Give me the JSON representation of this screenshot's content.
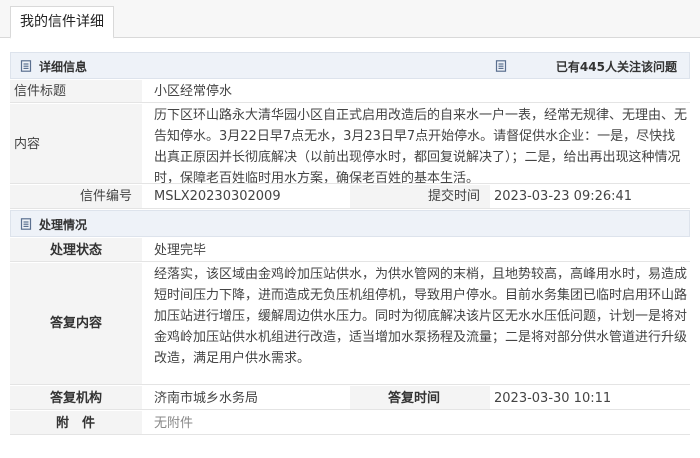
{
  "tab": {
    "label": "我的信件详细"
  },
  "detail_section": {
    "title": "详细信息",
    "follow_prefix": "已有",
    "follow_count": "445",
    "follow_suffix": "人关注该问题"
  },
  "letter": {
    "title_label": "信件标题",
    "title_value": "小区经常停水",
    "content_label": "内容",
    "content_value": "历下区环山路永大清华园小区自正式启用改造后的自来水一户一表，经常无规律、无理由、无告知停水。3月22日早7点无水，3月23日早7点开始停水。请督促供水企业：一是，尽快找出真正原因并长彻底解决（以前出现停水时，都回复说解决了）；二是，给出再出现这种情况时，保障老百姓临时用水方案，确保老百姓的基本生活。",
    "number_label": "信件编号",
    "number_value": "MSLX20230302009",
    "submit_label": "提交时间",
    "submit_value": "2023-03-23 09:26:41"
  },
  "process_section": {
    "title": "处理情况"
  },
  "process": {
    "status_label": "处理状态",
    "status_value": "处理完毕",
    "reply_label": "答复内容",
    "reply_value": "经落实，该区域由金鸡岭加压站供水，为供水管网的末梢，且地势较高，高峰用水时，易造成短时间压力下降，进而造成无负压机组停机，导致用户停水。目前水务集团已临时启用环山路加压站进行增压，缓解周边供水压力。同时为彻底解决该片区无水水压低问题，计划一是将对金鸡岭加压站供水机组进行改造，适当增加水泵扬程及流量；二是将对部分供水管道进行升级改造，满足用户供水需求。",
    "org_label": "答复机构",
    "org_value": "济南市城乡水务局",
    "reply_time_label": "答复时间",
    "reply_time_value": "2023-03-30 10:11",
    "attach_label": "附　件",
    "attach_value": "无附件"
  },
  "icons": {
    "detail": "document-icon",
    "follow": "people-icon",
    "process": "document-icon"
  }
}
